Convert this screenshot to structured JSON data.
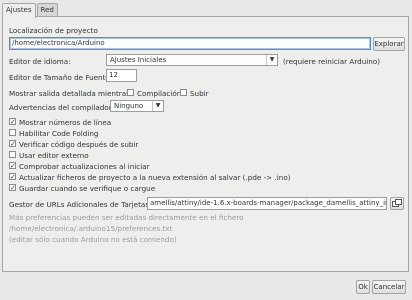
{
  "tabs": [
    {
      "label": "Ajustes"
    },
    {
      "label": "Red"
    }
  ],
  "sketchbook": {
    "label": "Localización de proyecto",
    "value": "/home/electronica/Arduino",
    "browse_label": "Explorar"
  },
  "language": {
    "label": "Editor de idioma:",
    "value": "Ajustes Iniciales",
    "note": "(requiere reiniciar Arduino)"
  },
  "font_size": {
    "label": "Editor de Tamaño de Fuente:",
    "value": "12"
  },
  "verbose": {
    "label": "Mostrar salida detallada mientras:",
    "compile_label": "Compilación",
    "upload_label": "Subir"
  },
  "warnings": {
    "label": "Advertencias del compilador:",
    "value": "Ninguno"
  },
  "options": [
    {
      "label": "Mostrar números de línea",
      "checked": true
    },
    {
      "label": "Habilitar Code Folding",
      "checked": false
    },
    {
      "label": "Verificar código después de subir",
      "checked": true
    },
    {
      "label": "Usar editor externo",
      "checked": false
    },
    {
      "label": "Comprobar actualizaciones al iniciar",
      "checked": true
    },
    {
      "label": "Actualizar ficheros de proyecto a la nueva extensión al salvar (.pde -> .ino)",
      "checked": true
    },
    {
      "label": "Guardar cuando se verifique o cargue",
      "checked": true
    }
  ],
  "board_urls": {
    "label": "Gestor de URLs Adicionales de Tarjetas:",
    "value": "amellis/attiny/ide-1.6.x-boards-manager/package_damellis_attiny_index.json"
  },
  "footer": {
    "more_prefs": "Más preferencias pueden ser editadas directamente en el fichero",
    "prefs_path": "/home/electronica/.arduino15/preferences.txt",
    "edit_note": "(editar sólo cuando Arduino no está corriendo)"
  },
  "buttons": {
    "ok": "Ok",
    "cancel": "Cancelar"
  }
}
